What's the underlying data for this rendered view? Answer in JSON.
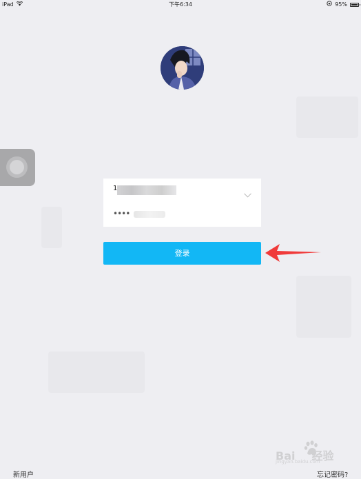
{
  "statusbar": {
    "device": "iPad",
    "time": "下午6:34",
    "battery": "95%",
    "battery_level": 0.95
  },
  "login": {
    "account_value": "1",
    "password_masked": "••••",
    "login_button_label": "登录"
  },
  "footer": {
    "new_user": "新用户",
    "forgot_password": "忘记密码?"
  },
  "watermark": {
    "brand": "Bai",
    "brand_suffix": "经验",
    "sub": "jingyan.baidu.com"
  },
  "colors": {
    "accent": "#12b7f5",
    "annotation_arrow": "#f03a3a",
    "background": "#eeeef2"
  }
}
